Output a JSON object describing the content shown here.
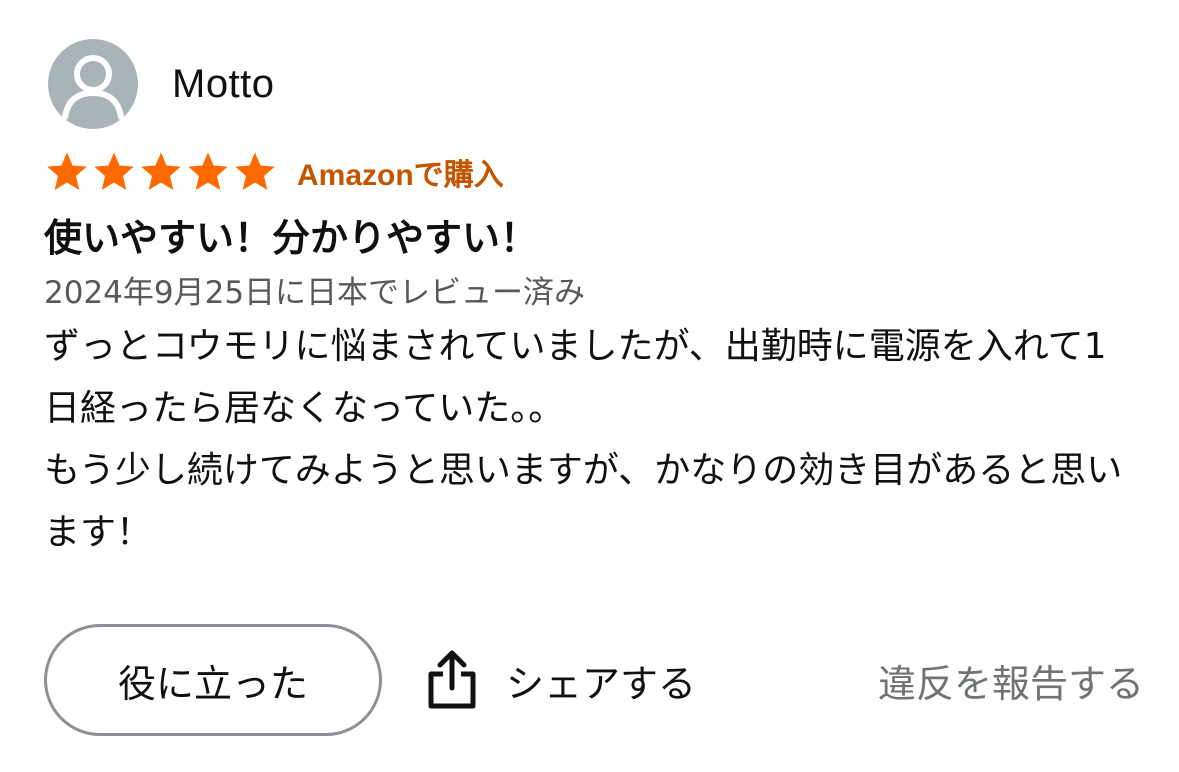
{
  "reviewer": {
    "name": "Motto",
    "avatar_icon": "user-silhouette-icon"
  },
  "rating": {
    "stars": 5,
    "max": 5,
    "star_color": "#ff6a00"
  },
  "badge": "Amazonで購入",
  "review": {
    "title": "使いやすい！分かりやすい！",
    "date": "2024年9月25日に日本でレビュー済み",
    "body": [
      "ずっとコウモリに悩まされていましたが、出勤時に電源を入れて1日経ったら居なくなっていた。。",
      "もう少し続けてみようと思いますが、かなりの効き目があると思います！"
    ]
  },
  "actions": {
    "helpful": "役に立った",
    "share": "シェアする",
    "share_icon": "share-icon",
    "report": "違反を報告する"
  },
  "colors": {
    "badge": "#c45500",
    "muted": "#565959",
    "report": "#6f7373"
  }
}
